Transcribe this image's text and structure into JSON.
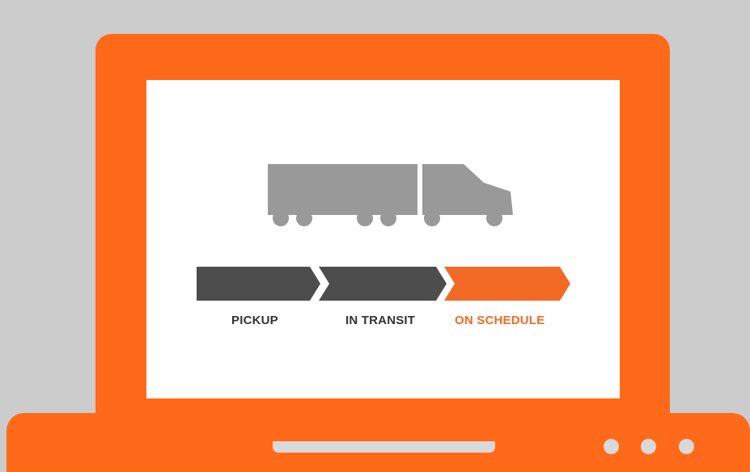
{
  "colors": {
    "background": "#cccccc",
    "device": "#ff6a1a",
    "screen": "#ffffff",
    "base_detail": "#d9d9d9",
    "truck": "#999999",
    "step_done": "#4d4d4d",
    "step_current": "#f26a26"
  },
  "truck": {
    "icon": "semi-truck-icon"
  },
  "progress": {
    "steps": [
      {
        "label": "PICKUP",
        "status": "done"
      },
      {
        "label": "IN TRANSIT",
        "status": "done"
      },
      {
        "label": "ON SCHEDULE",
        "status": "current"
      }
    ],
    "completed_steps": 3,
    "total_steps": 3
  },
  "device": {
    "indicator_lights": 3
  }
}
